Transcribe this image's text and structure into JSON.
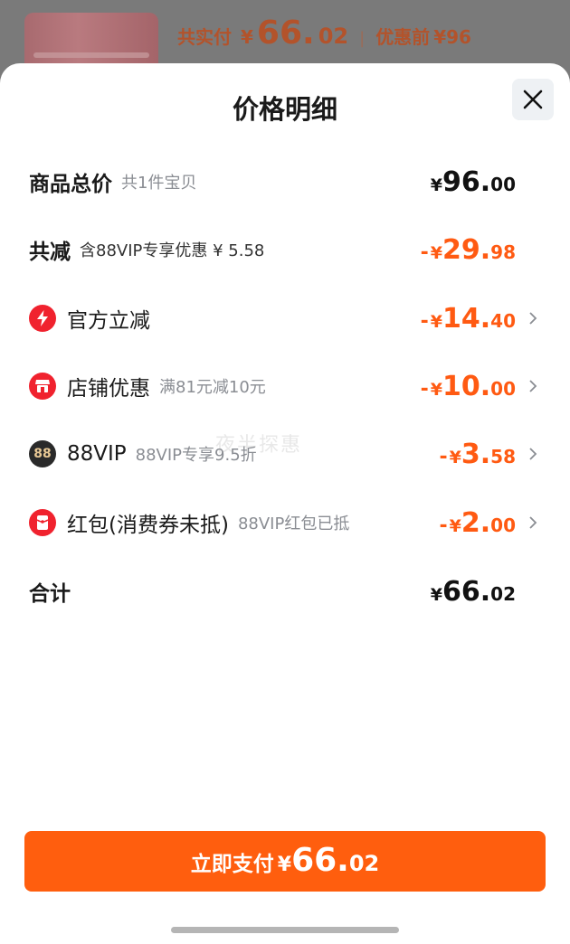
{
  "background": {
    "total_label": "共实付",
    "total_currency": "¥",
    "total_int": "66.",
    "total_dec": "02",
    "separator": "|",
    "before_label": "优惠前",
    "before_amount": "¥96"
  },
  "sheet": {
    "title": "价格明细",
    "close_icon": "close-icon"
  },
  "rows": {
    "goods_total": {
      "title": "商品总价",
      "sub": "共1件宝贝",
      "cur": "¥",
      "int": "96.",
      "dec": "00"
    },
    "total_discount": {
      "title": "共减",
      "sub": "含88VIP专享优惠 ¥ 5.58",
      "minus": "-",
      "cur": "¥",
      "int": "29.",
      "dec": "98"
    },
    "official": {
      "title": "官方立减",
      "sub": "",
      "minus": "-",
      "cur": "¥",
      "int": "14.",
      "dec": "40",
      "icon": "lightning-icon",
      "icon_color": "#f0222e"
    },
    "shop": {
      "title": "店铺优惠",
      "sub": "满81元减10元",
      "minus": "-",
      "cur": "¥",
      "int": "10.",
      "dec": "00",
      "icon": "shop-icon",
      "icon_color": "#f0222e"
    },
    "vip": {
      "title": "88VIP",
      "sub": "88VIP专享9.5折",
      "minus": "-",
      "cur": "¥",
      "int": "3.",
      "dec": "58",
      "icon": "vip-88-icon",
      "icon_color": "#2a2a2a",
      "icon_text": "88"
    },
    "redpacket": {
      "title": "红包(消费券未抵)",
      "sub": "88VIP红包已抵",
      "minus": "-",
      "cur": "¥",
      "int": "2.",
      "dec": "00",
      "icon": "red-packet-icon",
      "icon_color": "#f0222e"
    },
    "sum": {
      "title": "合计",
      "cur": "¥",
      "int": "66.",
      "dec": "02"
    }
  },
  "watermark": "夜半探惠",
  "pay_button": {
    "label": "立即支付",
    "cur": "¥",
    "int": "66.",
    "dec": "02"
  },
  "colors": {
    "accent": "#ff5e0e",
    "discount": "#ff5a12",
    "icon_red": "#f0222e"
  }
}
